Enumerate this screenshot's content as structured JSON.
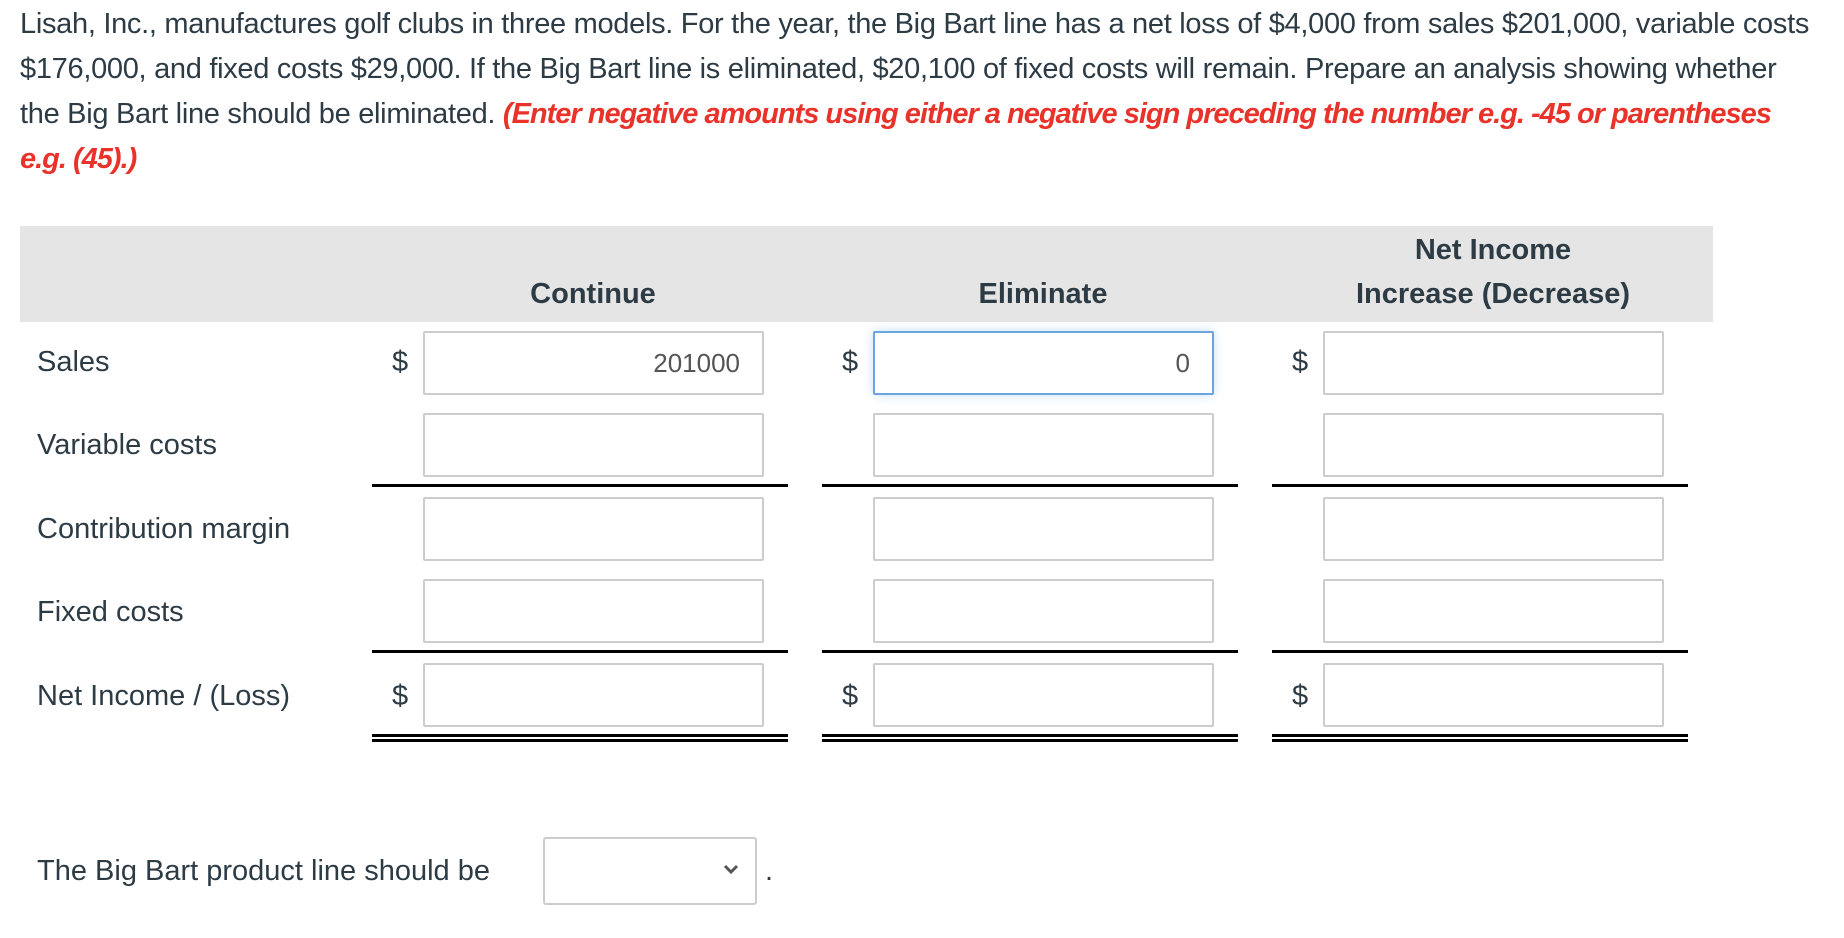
{
  "question": {
    "text": "Lisah, Inc., manufactures golf clubs in three models. For the year, the Big Bart line has a net loss of $4,000 from sales $201,000, variable costs $176,000, and fixed costs $29,000. If the Big Bart line is eliminated, $20,100 of fixed costs will remain. Prepare an analysis showing whether the Big Bart line should be eliminated.",
    "hint": "(Enter negative amounts using either a negative sign preceding the number e.g. -45 or parentheses e.g. (45).)"
  },
  "table": {
    "columns": [
      {
        "line1": "",
        "line2": "Continue"
      },
      {
        "line1": "",
        "line2": "Eliminate"
      },
      {
        "line1": "Net Income",
        "line2": "Increase (Decrease)"
      }
    ],
    "currency_symbol": "$",
    "rows": [
      {
        "label": "Sales",
        "values": [
          "201000",
          "0",
          ""
        ],
        "show_dollar": true
      },
      {
        "label": "Variable costs",
        "values": [
          "",
          "",
          ""
        ],
        "show_dollar": false
      },
      {
        "label": "Contribution margin",
        "values": [
          "",
          "",
          ""
        ],
        "show_dollar": false
      },
      {
        "label": "Fixed costs",
        "values": [
          "",
          "",
          ""
        ],
        "show_dollar": false
      },
      {
        "label": "Net Income / (Loss)",
        "values": [
          "",
          "",
          ""
        ],
        "show_dollar": true
      }
    ],
    "focused_cell": "sales-eliminate"
  },
  "conclusion": {
    "sentence": "The Big Bart product line should be",
    "selected_value": "",
    "period": "."
  },
  "colors": {
    "hint_red": "#e8322a",
    "header_bg": "#e5e5e5",
    "text": "#2d3b45",
    "focus_border": "#6aa5e0"
  }
}
